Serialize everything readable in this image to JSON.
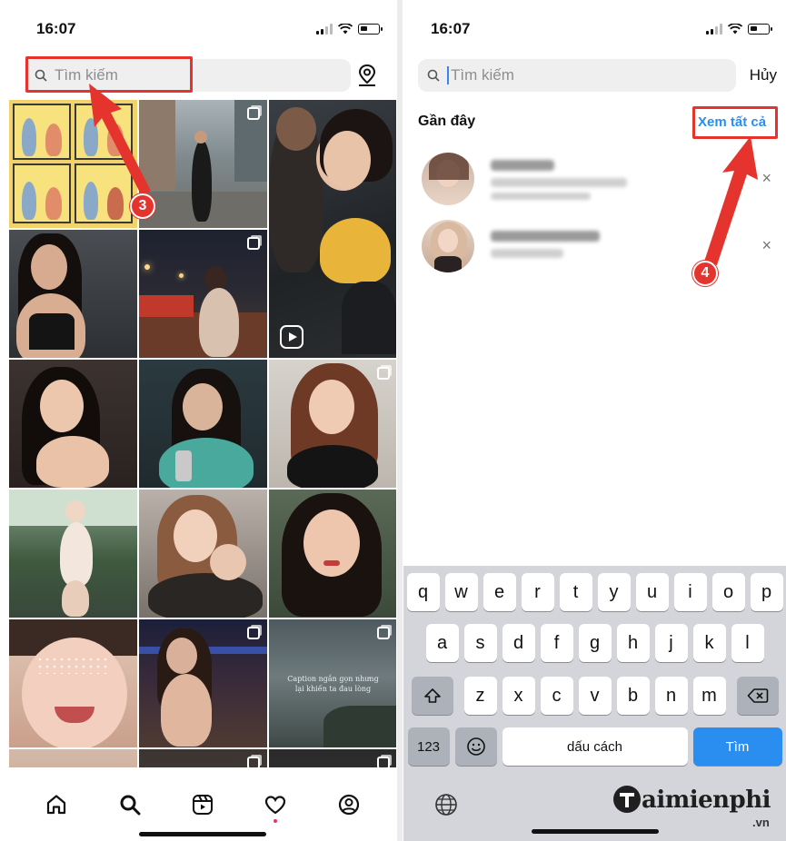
{
  "left_screen": {
    "status": {
      "time": "16:07"
    },
    "search": {
      "placeholder": "Tìm kiếm"
    },
    "step_badge": "3",
    "tiles": [
      {
        "kind": "comic"
      },
      {
        "kind": "street",
        "multi": true
      },
      {
        "kind": "crowd-portrait",
        "reel": true
      },
      {
        "kind": "portrait-dark"
      },
      {
        "kind": "night-city",
        "multi": true
      },
      {
        "kind": "portrait-warm"
      },
      {
        "kind": "selfie-teal"
      },
      {
        "kind": "portrait-black-dress",
        "multi": true
      },
      {
        "kind": "swimsuit"
      },
      {
        "kind": "selfie-jacket"
      },
      {
        "kind": "portrait-red"
      },
      {
        "kind": "glitter-face"
      },
      {
        "kind": "bar-girl",
        "multi": true
      },
      {
        "kind": "quote-sea",
        "multi": true,
        "quote": "Caption ngắn gọn nhưng lại khiến ta đau lòng"
      },
      {
        "kind": "partial-1"
      },
      {
        "kind": "partial-2",
        "multi": true
      },
      {
        "kind": "partial-3",
        "multi": true
      }
    ],
    "tab_bar": [
      "home-icon",
      "search-icon",
      "reels-icon",
      "heart-icon",
      "profile-icon"
    ]
  },
  "right_screen": {
    "status": {
      "time": "16:07"
    },
    "search": {
      "placeholder": "Tìm kiếm"
    },
    "cancel_label": "Hủy",
    "recent_title": "Gần đây",
    "view_all_label": "Xem tất cả",
    "step_badge": "4",
    "recent_items": [
      {
        "close": "×"
      },
      {
        "close": "×"
      }
    ],
    "keyboard": {
      "row1": [
        "q",
        "w",
        "e",
        "r",
        "t",
        "y",
        "u",
        "i",
        "o",
        "p"
      ],
      "row2": [
        "a",
        "s",
        "d",
        "f",
        "g",
        "h",
        "j",
        "k",
        "l"
      ],
      "row3": [
        "z",
        "x",
        "c",
        "v",
        "b",
        "n",
        "m"
      ],
      "numbers_label": "123",
      "space_label": "dấu cách",
      "go_label": "Tìm"
    }
  },
  "watermark": {
    "main": "aimienphi",
    "sub": ".vn"
  },
  "colors": {
    "accent_red": "#e5342d",
    "link_blue": "#2a8ef0",
    "keyboard_bg": "#d3d5da"
  }
}
